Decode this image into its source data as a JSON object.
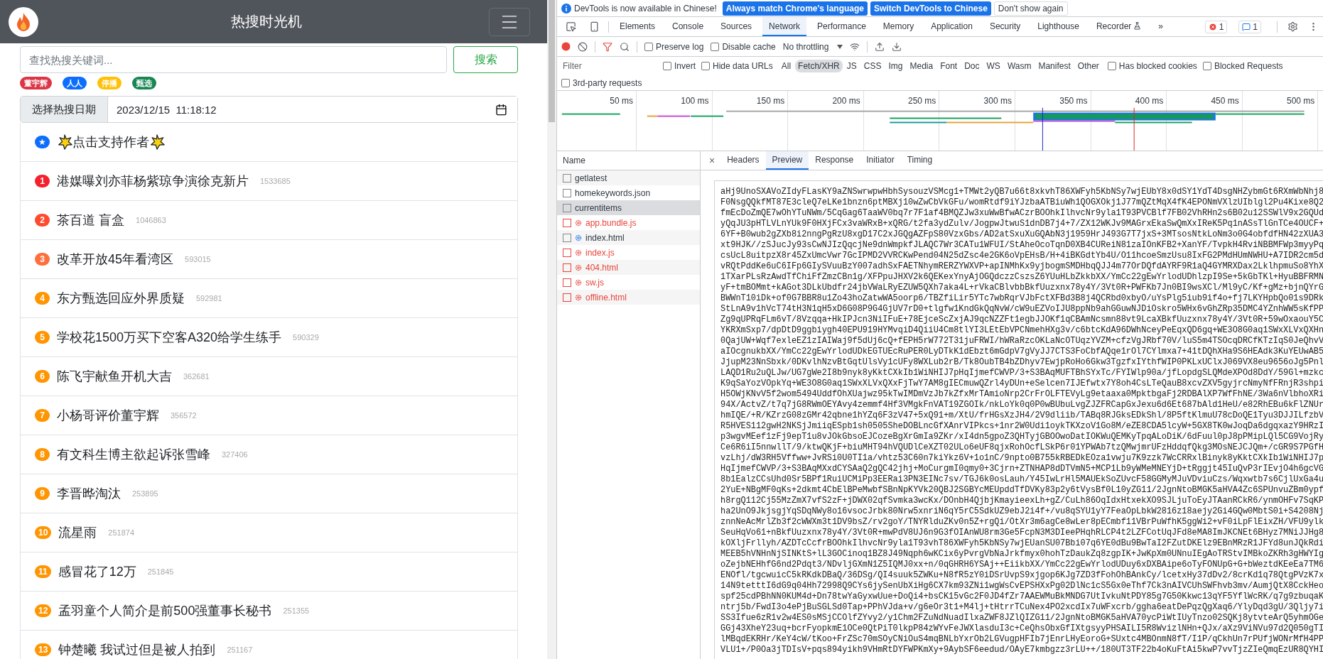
{
  "app": {
    "title": "热搜时光机",
    "search": {
      "placeholder": "查找热搜关键词...",
      "button": "搜索"
    },
    "tags": [
      {
        "label": "董宇辉",
        "color": "#dc3545"
      },
      {
        "label": "人人",
        "color": "#0d6efd"
      },
      {
        "label": "停播",
        "color": "#ffc107"
      },
      {
        "label": "甄选",
        "color": "#198754"
      }
    ],
    "date": {
      "label": "选择热搜日期",
      "value": "2023/12/15  11:18:12"
    },
    "support": {
      "badge": "★",
      "text": "点击支持作者"
    },
    "items": [
      {
        "rank": "1",
        "title": "港媒曝刘亦菲杨紫琼争演徐克新片",
        "heat": "1533685",
        "color": "#f5222d"
      },
      {
        "rank": "2",
        "title": "茶百道 盲盒",
        "heat": "1046863",
        "color": "#ff4a2e"
      },
      {
        "rank": "3",
        "title": "改革开放45年看湾区",
        "heat": "593015",
        "color": "#ff6f3c"
      },
      {
        "rank": "4",
        "title": "东方甄选回应外界质疑",
        "heat": "592981",
        "color": "#ff9500"
      },
      {
        "rank": "5",
        "title": "学校花1500万买下空客A320给学生练手",
        "heat": "590329",
        "color": "#ff9500"
      },
      {
        "rank": "6",
        "title": "陈飞宇献鱼开机大吉",
        "heat": "362681",
        "color": "#ff9500"
      },
      {
        "rank": "7",
        "title": "小杨哥评价董宇辉",
        "heat": "356572",
        "color": "#ff9500"
      },
      {
        "rank": "8",
        "title": "有文科生博主欲起诉张雪峰",
        "heat": "327406",
        "color": "#ff9500"
      },
      {
        "rank": "9",
        "title": "李晋晔淘汰",
        "heat": "253895",
        "color": "#ff9500"
      },
      {
        "rank": "10",
        "title": "流星雨",
        "heat": "251874",
        "color": "#ff9500"
      },
      {
        "rank": "11",
        "title": "感冒花了12万",
        "heat": "251845",
        "color": "#ff9500"
      },
      {
        "rank": "12",
        "title": "孟羽童个人简介是前500强董事长秘书",
        "heat": "251355",
        "color": "#ff9500"
      },
      {
        "rank": "13",
        "title": "钟楚曦 我试过但是被人拍到",
        "heat": "251167",
        "color": "#ff9500"
      }
    ]
  },
  "devtools": {
    "notice": {
      "text": "DevTools is now available in Chinese!",
      "buttons": [
        {
          "label": "Always match Chrome's language",
          "kind": "primary"
        },
        {
          "label": "Switch DevTools to Chinese",
          "kind": "primary"
        },
        {
          "label": "Don't show again",
          "kind": "plain"
        }
      ]
    },
    "tabs": [
      {
        "label": "Elements",
        "selected": false
      },
      {
        "label": "Console",
        "selected": false
      },
      {
        "label": "Sources",
        "selected": false
      },
      {
        "label": "Network",
        "selected": true
      },
      {
        "label": "Performance",
        "selected": false
      },
      {
        "label": "Memory",
        "selected": false
      },
      {
        "label": "Application",
        "selected": false
      },
      {
        "label": "Security",
        "selected": false
      },
      {
        "label": "Lighthouse",
        "selected": false
      },
      {
        "label": "Recorder",
        "selected": false
      }
    ],
    "more": "»",
    "errors": "1",
    "messages": "1",
    "toolbar": {
      "options": [
        {
          "label": "Preserve log",
          "checked": false
        },
        {
          "label": "Disable cache",
          "checked": false
        }
      ],
      "throttling": "No throttling"
    },
    "filter": {
      "placeholder": "Filter",
      "options": [
        {
          "label": "Invert",
          "checked": false
        },
        {
          "label": "Hide data URLs",
          "checked": false
        }
      ],
      "types": [
        {
          "label": "All",
          "selected": false
        },
        {
          "label": "Fetch/XHR",
          "selected": true
        },
        {
          "label": "JS",
          "selected": false
        },
        {
          "label": "CSS",
          "selected": false
        },
        {
          "label": "Img",
          "selected": false
        },
        {
          "label": "Media",
          "selected": false
        },
        {
          "label": "Font",
          "selected": false
        },
        {
          "label": "Doc",
          "selected": false
        },
        {
          "label": "WS",
          "selected": false
        },
        {
          "label": "Wasm",
          "selected": false
        },
        {
          "label": "Manifest",
          "selected": false
        },
        {
          "label": "Other",
          "selected": false
        }
      ],
      "extra_options": [
        {
          "label": "Has blocked cookies",
          "checked": false
        },
        {
          "label": "Blocked Requests",
          "checked": false
        }
      ],
      "third_party": {
        "label": "3rd-party requests",
        "checked": false
      }
    },
    "overview": {
      "ticks": [
        "50 ms",
        "100 ms",
        "150 ms",
        "200 ms",
        "250 ms",
        "300 ms",
        "350 ms",
        "400 ms",
        "450 ms",
        "500 ms"
      ]
    },
    "requests": {
      "column": "Name",
      "rows": [
        {
          "name": "getlatest",
          "kind": "fetch",
          "failed": false,
          "selected": false
        },
        {
          "name": "homekeywords.json",
          "kind": "fetch",
          "failed": false,
          "selected": false
        },
        {
          "name": "currentitems",
          "kind": "fetch",
          "failed": false,
          "selected": true
        },
        {
          "name": "app.bundle.js",
          "kind": "service_worker",
          "failed": true,
          "selected": false
        },
        {
          "name": "index.html",
          "kind": "service_worker",
          "failed": false,
          "selected": false
        },
        {
          "name": "index.js",
          "kind": "service_worker",
          "failed": true,
          "selected": false
        },
        {
          "name": "404.html",
          "kind": "service_worker",
          "failed": true,
          "selected": false
        },
        {
          "name": "sw.js",
          "kind": "service_worker",
          "failed": true,
          "selected": false
        },
        {
          "name": "offline.html",
          "kind": "service_worker",
          "failed": true,
          "selected": false
        }
      ]
    },
    "details": {
      "close": "×",
      "tabs": [
        {
          "label": "Headers",
          "selected": false
        },
        {
          "label": "Preview",
          "selected": true
        },
        {
          "label": "Response",
          "selected": false
        },
        {
          "label": "Initiator",
          "selected": false
        },
        {
          "label": "Timing",
          "selected": false
        }
      ],
      "preview_lines": [
        "aHj9UnoSXAVoZIdyFLasKY9aZNSwrwpwHbhSysouzVSMcg1+TMWt2yQB7u66t8xkvhT86XWFyh5KbNSy7wjEUbY8x0dSY1YdT4DsgNHZybmGt6RXmWbNhj8",
        "F0NsgQQkfMT87E3cleQ7eLKe1bnzn6ptMBXj10wZwCbVkGFu/womRtdf9iYJzbaATBiuWh1QOGXOkj1J77mQZtMqX4fK4EPONmVXlzUIblgl2Pu4Kixe8Q2",
        "fmEcDoZmQE7wOhYTuNWm/5CqGag6TaaWV0bq7r7F1af4BMQZJw3xuWwBfwACzrBOOhkIlhvcNr9yla1T93PVCBlf7FB02VhRHn2s6B02u12SSWlV9x2GQUd",
        "yQqJU3pHTLVLnYUk9F0HXjFCx3vaWRxB+xQRG/t2fa3ydZulv/JogpwJtwuS1dnDB7j4+7/ZX12WKJv9MAGrxEkaSwQmXxIReK5Pq1nASsTlGnTCe4OUCF+",
        "6YF+B0wub2gZXb8i2nngPgRzU8xgD17C2xJGQgAZFpS80VzxGbs/AD2atSxuXuGQAbN3j1959HrJ493G7T7jxS+3MTsosNtkLoNm3o0G4obfdfHN42zXUA3",
        "xt9HJK//zSJucJy93sCwNJIzQqcjNe9dnWmpkfJLAQC7Wr3CATu1WFUI/StAheOcoTqnD0XB4CUReiN81zaIOnKFB2+XanYF/TvpkH4RviNBBMFWp3myyPq",
        "csUcL8uitpzX8r45ZxUmcVwr7GcIPMD2VVRCKwPend04N25dZsc4e2GK6oVpEHsB/H+4iBKGdtYb4U/O11hcoeSmzUsu8IxFG2PMdHUmNWHU+A7IDR2cm5d",
        "vRQtPddKe6uC6IFp6GIySVuuBzY007adhSxFAETNhymRERZYWXVP+apINMhKx9yjbogmSMDHbqQJJ4m77OrDQfdAYRF9R1aQ4GYMRXDax2LklhpmuSo8YhX",
        "1TXarPLsRzAwdTfChiFfZmzCBn1g/XFPpuJHXV2k6QEKexYnyAjOGQdczzCszsZ6YUuHLbZkkbXX/YmCc22gEwYrlodUDhlzpI9Se+5kGbTKl+HyuBBFRMN",
        "yF+tmBOMmt+kAGot3DLkUbdfr24jbVWaLRyEZUW5QXh7aka4L+rVkaCBlvbbBkfUuzxnx78y4Y/3Vt0R+PWFKb7Jn0BI9wsXCl/Ml9yC/Kf+gMz+bjnQYrG",
        "BWWnT10iDk+of0G7BBR8u1Zo43hoZatwWA5oorp6/TBZfiLir5YTc7wbRqrVJbFctXFBd3B8j4QCRbd0xbyO/uYsPlg5iub9if4o+fj7LKYHpbQo01s9DRk",
        "StLnA9v1hVcT74tH3N1qH5xD6G08P9G4GjUV7rD0+tlgfw1KndGkQqNvW/cW9uEZVoIJU8ppNb9ahGGuwNJDiOskro5WHx6vGhZRp35DMC4YZnhWW5sKfPP",
        "Zg9qUPRqFLm6vT/8Vzqqa+HkIPJcn3NiIFuE+78EjceScZxjAJ9qcNZZFt1egbJJOKf1qCBAmNcsmn88vt9LcaXBkfUuzxnx78y4Y/3Vt0R+59wOxaouY5C",
        "YKRXmSxp7/dpDtD9ggbiygh40EPU919HYMvqiD4QiiU4Cm8tlYI3LEtEbVPCNmehHXg3v/c6btcKdA96DWhNceyPeEqxQD6gq+WE3O8G0aq1SWxXLVxQXHn",
        "0QajUW+Wqf7exleEZ1zIAIWaj9f5dUj6cQ+fEPH5rW772T31juFRWI/hWRaRzcOKLaNcOTUqzYVZM+cfzVgJRbf70V/luS5m4TSOcqDRCfKTzIqS0JeQhvV",
        "aIOcgnukbXX/YmCc22gEwYrlodUDkEGTUEcRuPER0LyDTkK1dEbzt6mGdpV7gVyJJ7CTS3FoCbfAQqe1rOl7CYlmxa7+41tDQhXHa9S6HEAdk3KuYEUwAB5",
        "JjupM23NnSbxk/0DKvlhNzvBtGqtUlsVy1cUFy8WXLub2rB/Tk8OubTB4bZDhyv7EwjpRoHo6Gkw3TgzfxIYthfWIP0PKLxUClxJ069VX8eu9656oJg5Pnl",
        "LAQD1Ru2uQLJw/UG7gWe2I8b9nyk8yKktCXkIb1WiNHIJ7pHqIjmefCWVP/3+S3BAqMUFTBhSYxTc/FYIWlp90a/jfLopdgSLQMdeXPOd8DdY/59Gl+mzkc",
        "K9qSaYozVOpkYq+WE3O8G0aq1SWxXLVxQXxFjTwY7AM8gIECmuwQZrl4yDUn+eSelcen7IJEfwtx7Y8oh4CsLTeQauB8xcvZXV5gyjrcNmyNfFRnjR3shpi",
        "H5OWjKNvV5f2wom5494UddfOhXUajwz95kTwIMDmVzJb7kZfxMrTAmioNrp2CrFrOLFTEVyLg9etaaxa0MpktbgaFj2RDBAlXP7WfFhNE/3Wa6nVlbhoXRi",
        "94X/ActvZ/t7q7jG8RWmOEYAvy4zemmf4Hf3VMgkFnVAT19ZGOIk/nkLoYk0q0P0wBUbuLvgZJZFRCapGxJexu6d6Et687bAld1HeU/e82RhEBu6kFlZNUr",
        "hmIQE/+R/KZrzG08zGMr42qbne1hYZq6F3zV47+5xQ91+m/XtU/frHGsXzJH4/2V9dliib/TABq8RJGksEDkShl/8P5ftKlmuU78cDoQE1Tyu3DJJILfzbV",
        "R5HVES112gwH2NKSjJmiiqESpb1sh0505SheDOBLncGfXAnrVIPkcs+1nr2W0Udi1oykTKXzoV1Go8M/eZE8CDA5lcyW+5GX8TK0wJoqDa6dgqxazY9HRzI",
        "p3wgvMEef1zFj9epT1u8vJOkGbsoEJCozeBgXrGmIa9ZKr/xI4dn5gpoZ3QHTyjGBOOwoDatIOKWuQEMKyTpqALoDiK/6dFuul0pJ8pPMipLQl5CG9VojRy",
        "Ce6R6iI5nnwllT/9/ktwQKjF+biuMHT94hVQUDlCeXZT02ULo6eUF8qjxRohOcfLSkP6r01YPWAb7tzQMwjmrUFzHddqfQkg3MOsNEJCJQm+/cGR9S7PGfH",
        "vzLhj/dW3RH5Vffww+JvRSi0U0TI1a/vhtz53C60n7kiYkz6V+1o1nC/9npto0B755kRBEDkEOza1vwju7K9zzk7WcCRRxlBinyk8yKktCXkIb1WiNHIJ7p",
        "HqIjmefCWVP/3+S3BAqMXxdCYSAaQ2gQC42jhj+MoCurgmI0qmy0+3Cjrn+ZTNHAP8dDTVmN5+MCP1Lb9yWMeMNEYjD+tRggjt45IuQvP3rIEvjO4h6gcVG",
        "8b1EalzCCsUhd0Sr5BPf1RuiUCMiPp3EERai3PN3EINc7sv/TGJ6k0osLauh/Y45IwLrHl5MAUEkSoZUvcF58GGMyMJuVDviuCzs/Wqxwtb7s6CjlUxGa4u",
        "2YuE+NBgMF0qKs+2dkmt4CbElBPeMwbfSBnNpKYVk20QBJ2SGBYcMEUpddTfDVKy83p2y6tVysBf0L10yZG11/2JgnNtoBMGK5aHVA4Zc6SPUnvuZBm0ypf",
        "h8rgQ112Cj55MzZmX7vfS2zF+jDWX02qfSvmka3wcKx/DOnbH4QjbjKmayieexLh+gZ/CuLh86OqIdxHtxekXO9SJLjuToEyJTAanRCkR6/ynmOHFv7SqKP",
        "ha2UnO9JkjsgjYqSDqNWy8o16vsocJrbk80Nrw5xnriN6qY5rC5SdkUZ9ebJ2i4f+/vu8qSYU1yY7FeaOpLbkW2816z18aejy2Gi4GQw0MbtS0i+S4208Nj",
        "znnNeAcMrlZb3f2cWWXm3t1DV9bsZ/rv2goY/TNYRlduZKv0n5Z+rgQi/OtXr3m6agCe8wLer8pECmbf11VBrPuWfhK5ggWi2+vF0iLpFlEixZH/VFU9ylk",
        "SeuHqVo61+nBkfUuzxnx78y4Y/3Vt0R+mwPdV8UJ6n9G3fOIAnWU8rm3Ge5FcpN3M3DIeePHqhRLCP4t2LZFCotUqJFd8eMA8ImJKCNEt6BHyz7MNiJJHg8",
        "kOXljFrllyh/AZDTcCcfrBOOhkIlhvcNr9yla1T93vhT86XWFyh5KbNSy7wjEUanSU07Bbi07q6YE0dBu9BwTaI2FZutDKElz9EBnMRzR1JFYd8unJQkRdi",
        "MEEB5hVNHnNjSINKtS+lL3GOCinoq1BZ8J49Nqph6wKCix6yPvrgVbNaJrkfmyx0hohTzDaukZq8zgpIK+JwKpXm0UNnuIEgAoTRStvIMBkoZKRh3gHWYIg",
        "oZejbNEHhfG6nd2Pdqt3/NDvljGXmN1Z5IQMJ0xx+n/0qGHRH6YSAj++EiikbXX/YmCc22gEwYrlodUDuy6xDXBAipe6oTyFONUpG+G+bWeztdKEeEa7TM6",
        "ENOfl/tgcwuicC5kRKdkDBaQ/36DSg/QI4suuk5ZWKu+N8fR5zY0iDSrUvpS9xjgop6KJg7ZD3fFohOhBAnkCy/lcetxHy37dDv2/8crKd1q78QtgPVzK7x",
        "14N9tetttI6dG9q04Hh72998Q9CYs6jySenUbXiHg6CX7km93ZNi1wgWsCvEPSHXxPg02DlNc1cS5Gx0eThf7Ck3nAIVCUhSWFhvb3mv/AumjQtX8CckHeo",
        "spf25cdPBhNN0KUM4d+Dn78twYaGyxwUue+DoQi4+bsCK15vGc2F0JD4fZr7AAEWMuBkMNDG7UtIvkuNtPDY85g7G50Kkwc13qYF5YflWcRK/q7g9zbuqaK",
        "ntrj5b/FwdI3o4ePjBuSGLSd0Tap+PPhVJda+v/g6eOr3t1+M4lj+tHtrrTCuNex4PO2xcdIx7uWFxcrb/ggha6eatDePqzQgXaq6/YlyDqd3gU/3Qljy7i",
        "SS3Ifue6zR1v2w4ES0sMSjCCOlfZYvy2/y1Chm2FZuNdNuadIlxaZWF8JZlQIZG11/2JgnNtoBMGK5aHVA70ycPiWtIUyTnzo02SQKj8ytvteArQ5yhmOGe",
        "GGj43XheY23uq+bcrFyopkmE1OCe0QtPiT0lkpP84zWYvFeJWXlasduI3c+CeQhsObxGfIXtgsyyPHSAILI5R8WvizlNHn+QJx/aXz9ViNVu97d2Q050gTI",
        "lMBqdEKRHr/KeY4cW/tKoo+FrZSc70mSOyCNiOuS4mqBNLbYxrOb2LGVugpHFIb7jEnrLHyEoroG+SUxtc4MBOnmN8fT/I1P/qCkhUn7rPUfjWONrMfH4PP",
        "VLU1+/P0Oa3jTDIsV+pqs894yikh9VHmRtDYFWPKmXy+9AybSF6eedud/OAyE7kmbgzz3rLU++/180UT3TF22b4oKuFtAi5kwP7vvTjzZIeQmqEzUR8QYHI"
      ]
    }
  }
}
